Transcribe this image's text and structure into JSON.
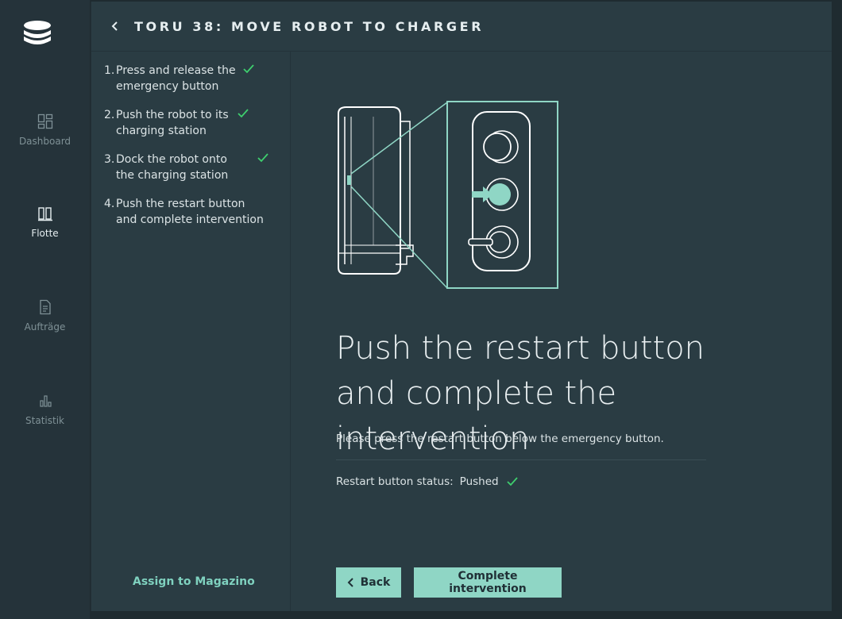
{
  "app": {
    "logo_icon": "stacked-discs-logo"
  },
  "nav": {
    "items": [
      {
        "label": "Dashboard",
        "icon": "dashboard-icon",
        "active": false
      },
      {
        "label": "Flotte",
        "icon": "fleet-icon",
        "active": true
      },
      {
        "label": "Aufträge",
        "icon": "document-icon",
        "active": false
      },
      {
        "label": "Statistik",
        "icon": "bar-chart-icon",
        "active": false
      }
    ]
  },
  "header": {
    "title": "TORU 38: MOVE ROBOT TO CHARGER",
    "back_icon": "chevron-left-icon"
  },
  "steps": [
    {
      "number": "1.",
      "text": "Press and release the emergency button",
      "done": true
    },
    {
      "number": "2.",
      "text": "Push the robot to its charging station",
      "done": true
    },
    {
      "number": "3.",
      "text": "Dock the robot onto the charging station",
      "done": true
    },
    {
      "number": "4.",
      "text": "Push the restart button and complete intervention",
      "done": false
    }
  ],
  "assign_link": "Assign to Magazino",
  "main": {
    "headline_line1": "Push the restart button",
    "headline_line2": "and complete the intervention",
    "description": "Please press the restart button below the emergency button.",
    "status_label": "Restart button status:",
    "status_value": "Pushed"
  },
  "buttons": {
    "back": "Back",
    "complete": "Complete intervention"
  },
  "colors": {
    "accent": "#8fd6c5",
    "check": "#3ecf6e",
    "panel_bg": "#2a3c43",
    "nav_bg": "#25333a"
  }
}
